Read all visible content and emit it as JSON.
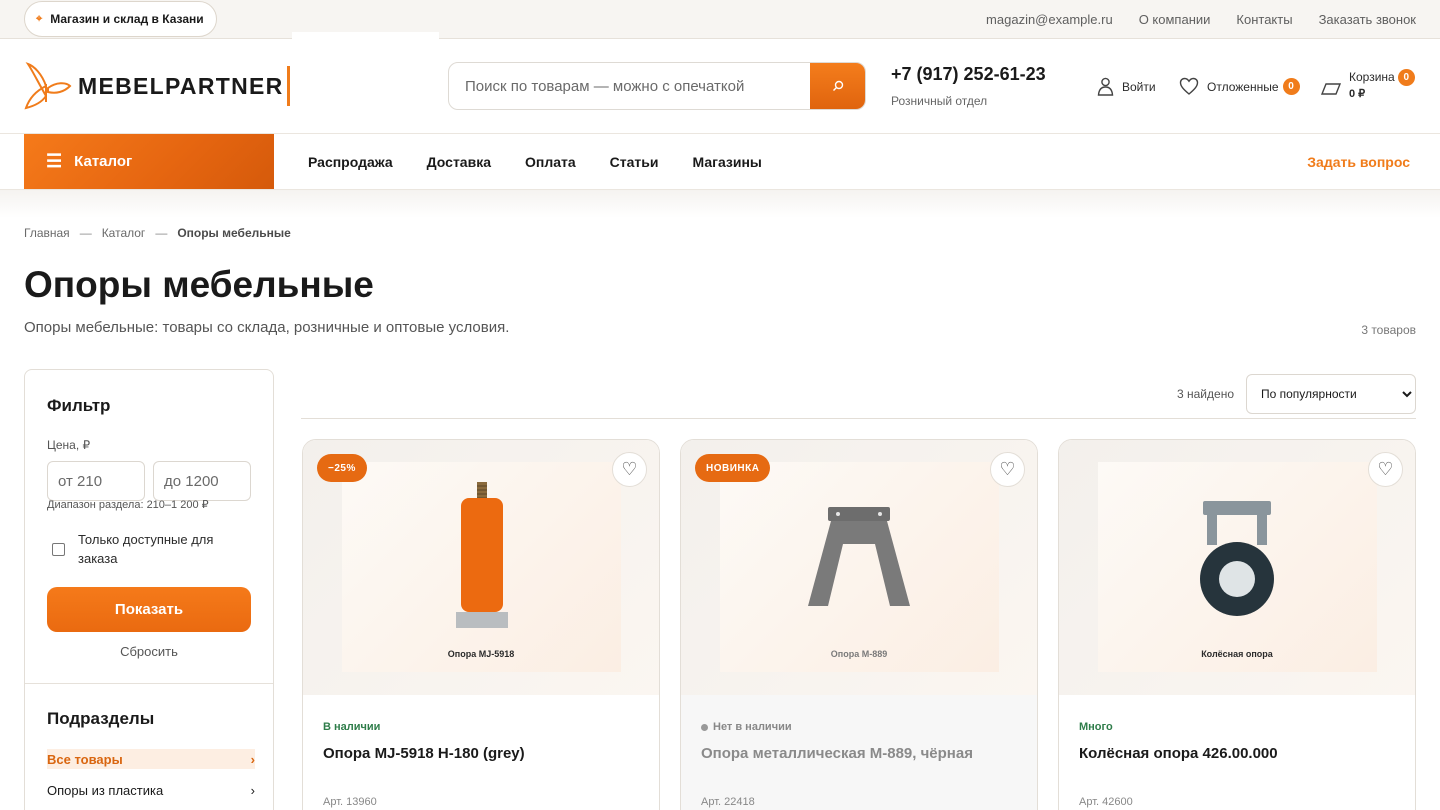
{
  "topbar": {
    "store_label": "Магазин и склад в Казани",
    "links": [
      "magazin@example.ru",
      "О компании",
      "Контакты",
      "Заказать звонок"
    ]
  },
  "header": {
    "logo_text": "MEBELPARTNER",
    "search_placeholder": "Поиск по товарам — можно с опечаткой",
    "phone": "+7 (917) 252-61-23",
    "phone_caption": "Розничный отдел",
    "login_label": "Войти",
    "favorites_label": "Отложенные",
    "favorites_count": "0",
    "cart_label": "Корзина",
    "cart_sum": "0 ₽",
    "cart_count": "0"
  },
  "nav": {
    "catalog_label": "Каталог",
    "links": [
      "Распродажа",
      "Доставка",
      "Оплата",
      "Статьи",
      "Магазины"
    ],
    "ask_label": "Задать вопрос"
  },
  "breadcrumb": [
    "Главная",
    "Каталог",
    "Опоры мебельные"
  ],
  "breadcrumb_sep": "—",
  "page": {
    "title": "Опоры мебельные",
    "subtitle": "Опоры мебельные: товары со склада, розничные и оптовые условия.",
    "count_label": "3 товаров"
  },
  "filter": {
    "title": "Фильтр",
    "price_label": "Цена, ₽",
    "price_from_placeholder": "от 210",
    "price_to_placeholder": "до 1200",
    "range_note": "Диапазон раздела: 210–1 200 ₽",
    "only_available_label": "Только доступные для заказа",
    "show_label": "Показать",
    "reset_label": "Сбросить"
  },
  "subsections": {
    "title": "Подразделы",
    "items": [
      {
        "label": "Все товары",
        "active": true
      },
      {
        "label": "Опоры из пластика",
        "active": false
      }
    ]
  },
  "listing": {
    "found_label": "3 найдено",
    "sort_selected": "По популярности"
  },
  "products": [
    {
      "badge": "−25%",
      "image_caption": "Опора MJ-5918",
      "stock": "В наличии",
      "name": "Опора MJ-5918 H-180 (grey)",
      "sku": "Арт. 13960"
    },
    {
      "badge": "НОВИНКА",
      "image_caption": "Опора М-889",
      "stock": "Нет в наличии",
      "name": "Опора металлическая М-889, чёрная",
      "sku": "Арт. 22418"
    },
    {
      "badge": "",
      "image_caption": "Колёсная опора",
      "stock": "Много",
      "name": "Колёсная опора 426.00.000",
      "sku": "Арт. 42600"
    }
  ],
  "colors": {
    "accent": "#f07c1b",
    "in_stock": "#2f7d4a",
    "out_of_stock": "#888888"
  },
  "icons": {
    "store_pin": "map-pin-icon",
    "search": "search-icon",
    "login": "user-icon",
    "favorites": "heart-icon",
    "cart": "cart-icon",
    "catalog": "menu-icon",
    "subsection_arrow": "chevron-right-icon"
  }
}
